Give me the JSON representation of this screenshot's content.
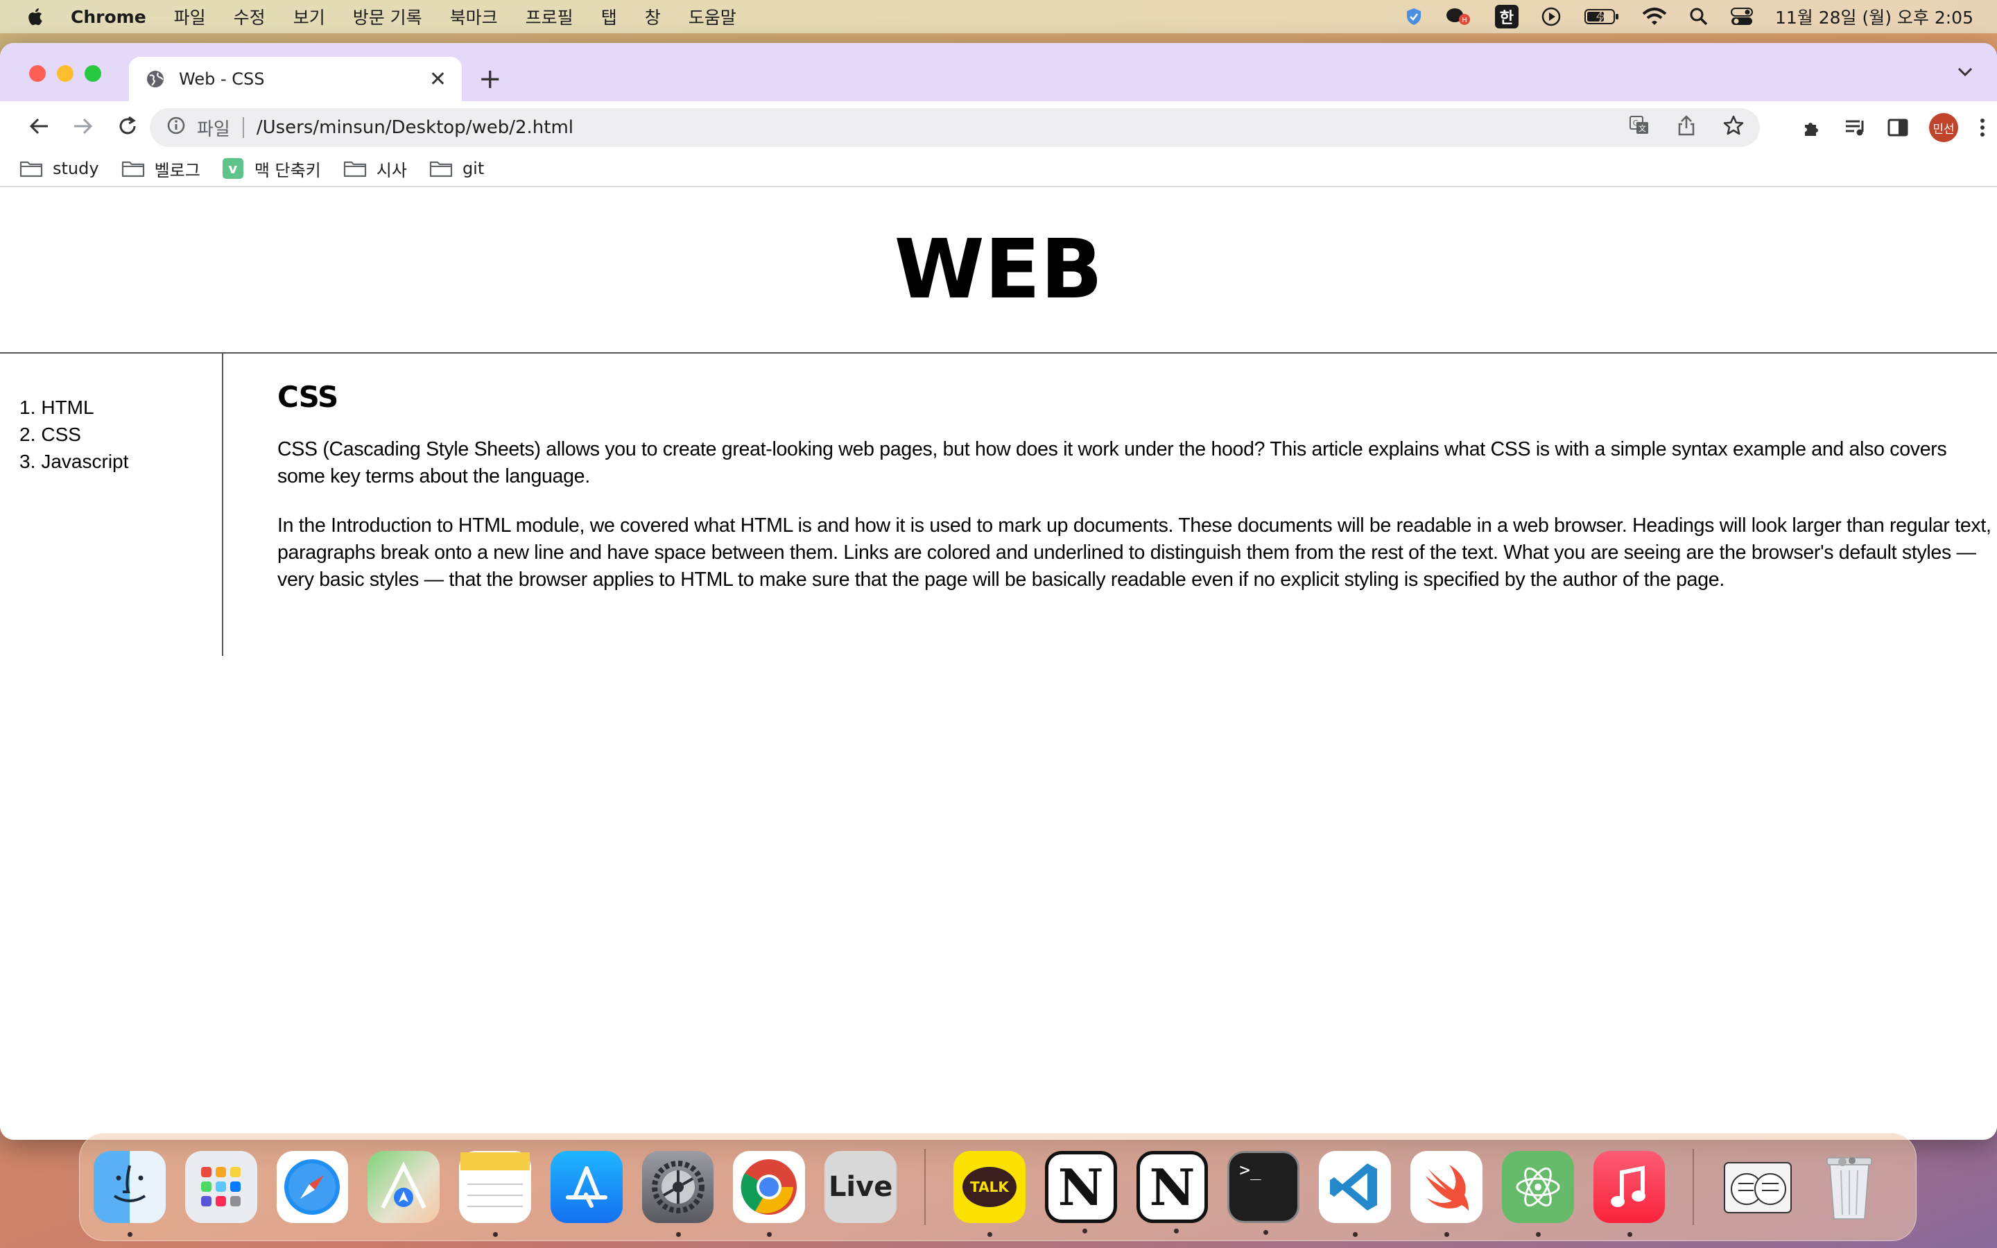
{
  "menubar": {
    "app_name": "Chrome",
    "menus": [
      "파일",
      "수정",
      "보기",
      "방문 기록",
      "북마크",
      "프로필",
      "탭",
      "창",
      "도움말"
    ],
    "ime": "한",
    "clock": "11월 28일 (월) 오후 2:05"
  },
  "browser": {
    "tab_title": "Web - CSS",
    "new_tab_label": "+",
    "address_scheme": "파일",
    "address_url": "/Users/minsun/Desktop/web/2.html",
    "profile_initials": "민선",
    "bookmarks": [
      {
        "label": "study",
        "icon": "folder-icon"
      },
      {
        "label": "벨로그",
        "icon": "folder-icon"
      },
      {
        "label": "맥 단축키",
        "icon": "v-icon"
      },
      {
        "label": "시사",
        "icon": "folder-icon"
      },
      {
        "label": "git",
        "icon": "folder-icon"
      }
    ],
    "vbadge_letter": "v"
  },
  "page": {
    "site_title": "WEB",
    "nav": [
      {
        "num": "1.",
        "label": "HTML"
      },
      {
        "num": "2.",
        "label": "CSS"
      },
      {
        "num": "3.",
        "label": "Javascript"
      }
    ],
    "heading": "CSS",
    "paragraphs": [
      "CSS (Cascading Style Sheets) allows you to create great-looking web pages, but how does it work under the hood? This article explains what CSS is with a simple syntax example and also covers some key terms about the language.",
      "In the Introduction to HTML module, we covered what HTML is and how it is used to mark up documents. These documents will be readable in a web browser. Headings will look larger than regular text, paragraphs break onto a new line and have space between them. Links are colored and underlined to distinguish them from the rest of the text. What you are seeing are the browser's default styles — very basic styles — that the browser applies to HTML to make sure that the page will be basically readable even if no explicit styling is specified by the author of the page."
    ]
  },
  "dock": {
    "live_label": "Live",
    "talk_label": "TALK",
    "notion_letter": "N",
    "terminal_prompt": ">_",
    "apps": [
      "Finder",
      "Launchpad",
      "Safari",
      "Maps",
      "Notes",
      "App Store",
      "System Settings",
      "Chrome",
      "Live",
      "KakaoTalk",
      "Notion",
      "Notion",
      "Terminal",
      "VS Code",
      "Swift Playgrounds",
      "Atom",
      "Music",
      "Downloads",
      "Trash"
    ]
  },
  "colors": {
    "tab_strip": "#e4d9f8",
    "close": "#fe5f57",
    "minimize": "#febc2e",
    "maximize": "#28c840",
    "avatar": "#c0432b"
  }
}
